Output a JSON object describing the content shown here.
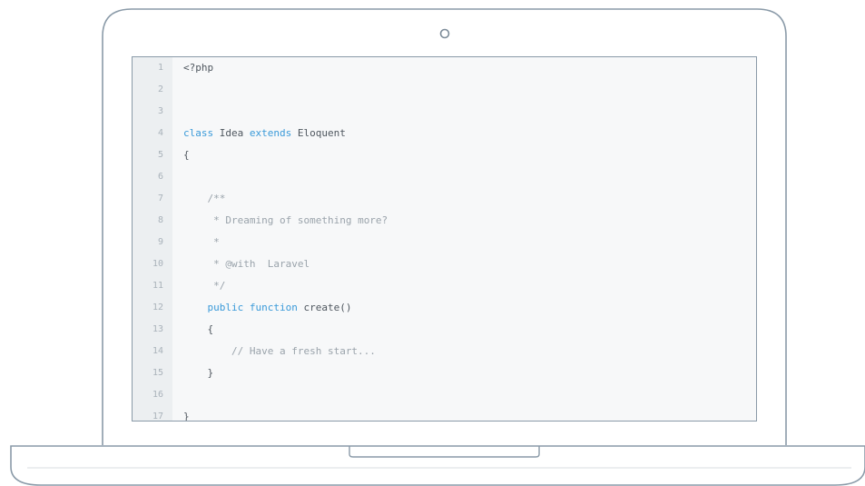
{
  "editor": {
    "lines": [
      {
        "number": "1",
        "indent": "",
        "tokens": [
          {
            "t": "<?php",
            "k": "plain"
          }
        ]
      },
      {
        "number": "2",
        "indent": "",
        "tokens": []
      },
      {
        "number": "3",
        "indent": "",
        "tokens": []
      },
      {
        "number": "4",
        "indent": "",
        "tokens": [
          {
            "t": "class",
            "k": "kw"
          },
          {
            "t": " Idea ",
            "k": "plain"
          },
          {
            "t": "extends",
            "k": "kw"
          },
          {
            "t": " Eloquent",
            "k": "plain"
          }
        ]
      },
      {
        "number": "5",
        "indent": "",
        "tokens": [
          {
            "t": "{",
            "k": "plain"
          }
        ]
      },
      {
        "number": "6",
        "indent": "",
        "tokens": []
      },
      {
        "number": "7",
        "indent": "    ",
        "tokens": [
          {
            "t": "/**",
            "k": "comment"
          }
        ]
      },
      {
        "number": "8",
        "indent": "     ",
        "tokens": [
          {
            "t": "* Dreaming of something more?",
            "k": "comment"
          }
        ]
      },
      {
        "number": "9",
        "indent": "     ",
        "tokens": [
          {
            "t": "*",
            "k": "comment"
          }
        ]
      },
      {
        "number": "10",
        "indent": "     ",
        "tokens": [
          {
            "t": "* @with  Laravel",
            "k": "comment"
          }
        ]
      },
      {
        "number": "11",
        "indent": "     ",
        "tokens": [
          {
            "t": "*/",
            "k": "comment"
          }
        ]
      },
      {
        "number": "12",
        "indent": "    ",
        "tokens": [
          {
            "t": "public",
            "k": "kw"
          },
          {
            "t": " ",
            "k": "plain"
          },
          {
            "t": "function",
            "k": "kw"
          },
          {
            "t": " create()",
            "k": "plain"
          }
        ]
      },
      {
        "number": "13",
        "indent": "    ",
        "tokens": [
          {
            "t": "{",
            "k": "plain"
          }
        ]
      },
      {
        "number": "14",
        "indent": "        ",
        "tokens": [
          {
            "t": "// Have a fresh start...",
            "k": "comment"
          }
        ]
      },
      {
        "number": "15",
        "indent": "    ",
        "tokens": [
          {
            "t": "}",
            "k": "plain"
          }
        ]
      },
      {
        "number": "16",
        "indent": "",
        "tokens": []
      },
      {
        "number": "17",
        "indent": "",
        "tokens": [
          {
            "t": "}",
            "k": "plain"
          }
        ]
      }
    ]
  },
  "colors": {
    "keyword": "#3a9ad9",
    "comment": "#9aa3ab",
    "outline": "#8a9aa8"
  },
  "icons": {
    "camera": "webcam-icon"
  }
}
